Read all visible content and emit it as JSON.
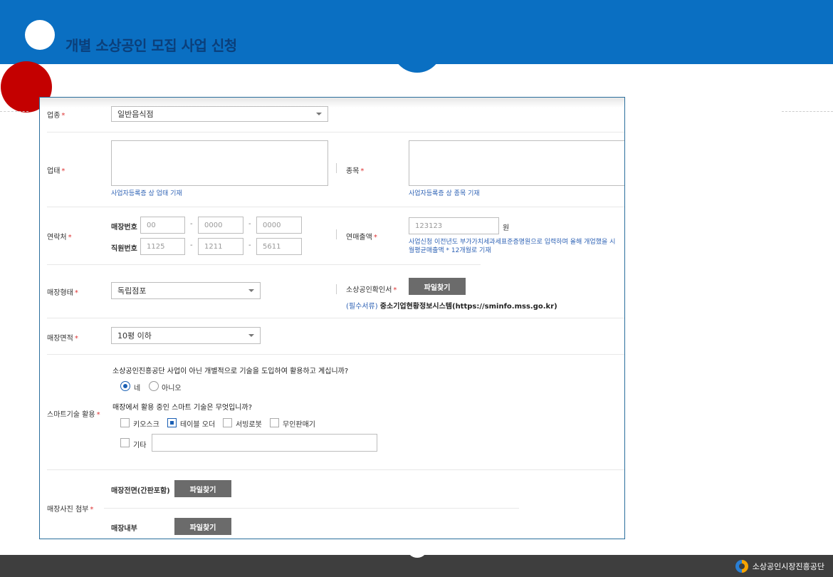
{
  "header": {
    "title": "개별 소상공인 모집 사업 신청"
  },
  "footer": {
    "logo_text": "소상공인시장진흥공단"
  },
  "form": {
    "industry": {
      "label": "업종",
      "value": "일반음식점"
    },
    "business_type": {
      "label": "업태",
      "hint": "사업자등록증 상 업태 기재"
    },
    "item": {
      "label": "종목",
      "hint": "사업자등록증 상 종목 기재"
    },
    "contact": {
      "label": "연락처",
      "store_label": "매장번호",
      "store": [
        "00",
        "0000",
        "0000"
      ],
      "staff_label": "직원번호",
      "staff": [
        "1125",
        "1211",
        "5611"
      ]
    },
    "sales": {
      "label": "연매출액",
      "value": "123123",
      "unit": "원",
      "hint_line1": "사업신청 이전년도 부가가치세과세표준증명원으로 입력하며 올해 개업했을 시",
      "hint_line2": "월평균매출액 * 12개월로 기재"
    },
    "store_form": {
      "label": "매장형태",
      "value": "독립점포"
    },
    "certificate": {
      "label": "소상공인확인서",
      "button": "파일찾기",
      "note_prefix": "(필수서류)",
      "note_text": "중소기업현황정보시스템(https://sminfo.mss.go.kr)"
    },
    "store_area": {
      "label": "매장면적",
      "value": "10평 이하"
    },
    "smart_tech": {
      "label": "스마트기술 활용",
      "question1": "소상공인진흥공단 사업이 아닌 개별적으로 기술을 도입하여 활용하고 계십니까?",
      "yes": "네",
      "no": "아니오",
      "question2": "매장에서 활용 중인 스마트 기술은 무엇입니까?",
      "options": [
        "키오스크",
        "테이블 오더",
        "서빙로봇",
        "무인판매기"
      ],
      "other": "기타"
    },
    "photos": {
      "label": "매장사진 첨부",
      "front_label": "매장전면(간판포함)",
      "inside_label": "매장내부",
      "button": "파일찾기"
    }
  }
}
